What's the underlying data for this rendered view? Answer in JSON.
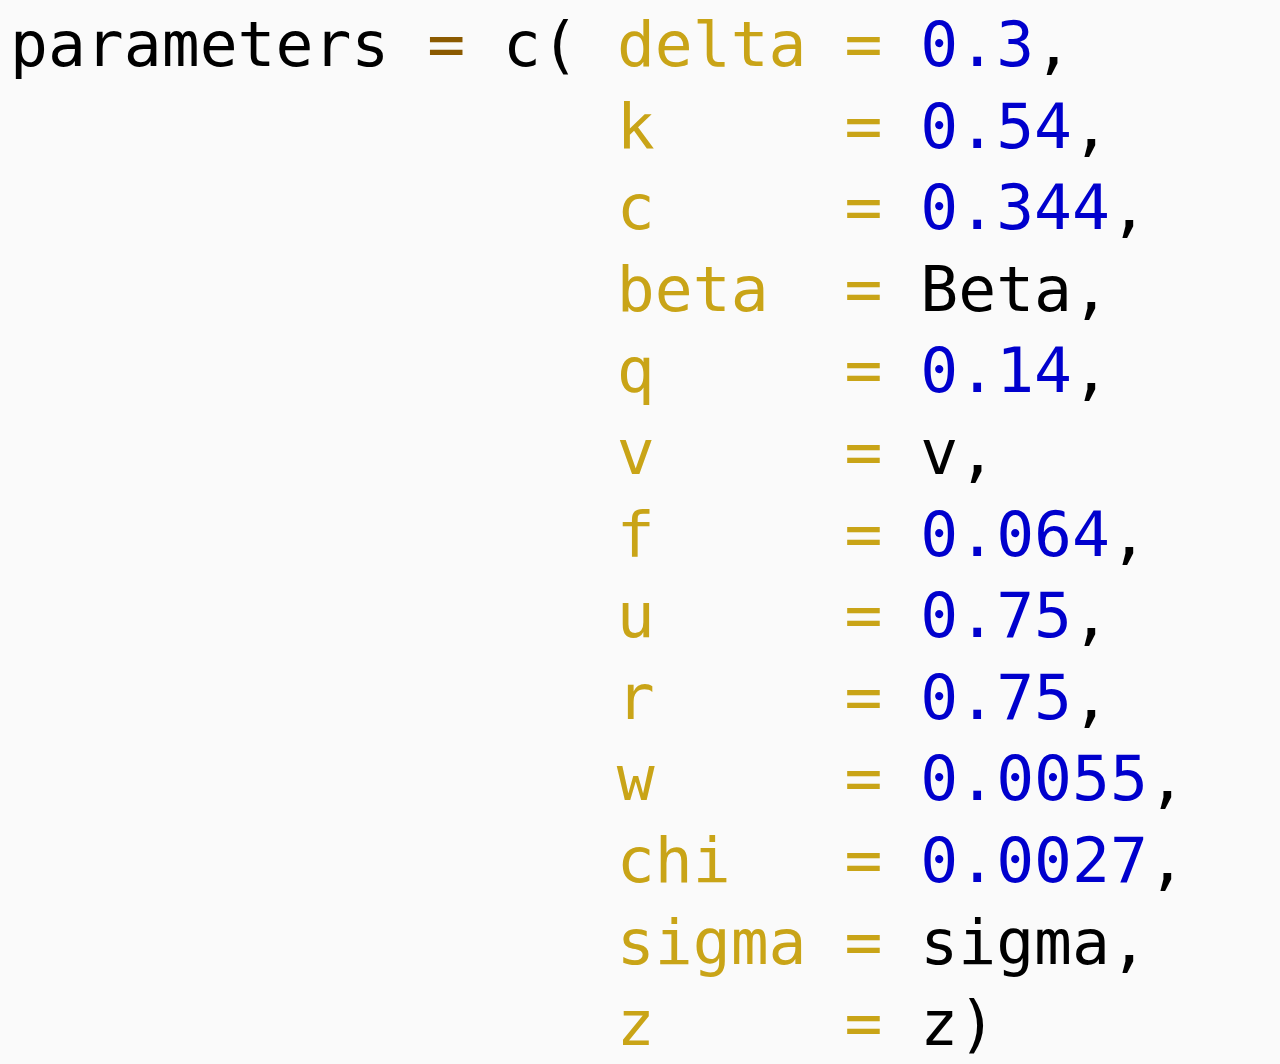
{
  "code": {
    "lines": [
      {
        "kind": "first",
        "tokens": [
          {
            "kind": "plain",
            "text": "parameters "
          },
          {
            "kind": "operator",
            "text": "="
          },
          {
            "kind": "plain",
            "text": " c( "
          },
          {
            "kind": "argument",
            "text": "delta = "
          },
          {
            "kind": "number",
            "text": "0.3"
          },
          {
            "kind": "plain",
            "text": ","
          }
        ]
      },
      {
        "kind": "continuation",
        "tokens": [
          {
            "kind": "argument",
            "text": "k     = "
          },
          {
            "kind": "number",
            "text": "0.54"
          },
          {
            "kind": "plain",
            "text": ","
          }
        ]
      },
      {
        "kind": "continuation",
        "tokens": [
          {
            "kind": "argument",
            "text": "c     = "
          },
          {
            "kind": "number",
            "text": "0.344"
          },
          {
            "kind": "plain",
            "text": ","
          }
        ]
      },
      {
        "kind": "continuation",
        "tokens": [
          {
            "kind": "argument",
            "text": "beta  = "
          },
          {
            "kind": "plain",
            "text": "Beta,"
          }
        ]
      },
      {
        "kind": "continuation",
        "tokens": [
          {
            "kind": "argument",
            "text": "q     = "
          },
          {
            "kind": "number",
            "text": "0.14"
          },
          {
            "kind": "plain",
            "text": ","
          }
        ]
      },
      {
        "kind": "continuation",
        "tokens": [
          {
            "kind": "argument",
            "text": "v     = "
          },
          {
            "kind": "plain",
            "text": "v,"
          }
        ]
      },
      {
        "kind": "continuation",
        "tokens": [
          {
            "kind": "argument",
            "text": "f     = "
          },
          {
            "kind": "number",
            "text": "0.064"
          },
          {
            "kind": "plain",
            "text": ","
          }
        ]
      },
      {
        "kind": "continuation",
        "tokens": [
          {
            "kind": "argument",
            "text": "u     = "
          },
          {
            "kind": "number",
            "text": "0.75"
          },
          {
            "kind": "plain",
            "text": ","
          }
        ]
      },
      {
        "kind": "continuation",
        "tokens": [
          {
            "kind": "argument",
            "text": "r     = "
          },
          {
            "kind": "number",
            "text": "0.75"
          },
          {
            "kind": "plain",
            "text": ","
          }
        ]
      },
      {
        "kind": "continuation",
        "tokens": [
          {
            "kind": "argument",
            "text": "w     = "
          },
          {
            "kind": "number",
            "text": "0.0055"
          },
          {
            "kind": "plain",
            "text": ","
          }
        ]
      },
      {
        "kind": "continuation",
        "tokens": [
          {
            "kind": "argument",
            "text": "chi   = "
          },
          {
            "kind": "number",
            "text": "0.0027"
          },
          {
            "kind": "plain",
            "text": ","
          }
        ]
      },
      {
        "kind": "continuation",
        "tokens": [
          {
            "kind": "argument",
            "text": "sigma = "
          },
          {
            "kind": "plain",
            "text": "sigma,"
          }
        ]
      },
      {
        "kind": "continuation",
        "tokens": [
          {
            "kind": "argument",
            "text": "z     = "
          },
          {
            "kind": "plain",
            "text": "z)"
          }
        ]
      }
    ]
  }
}
